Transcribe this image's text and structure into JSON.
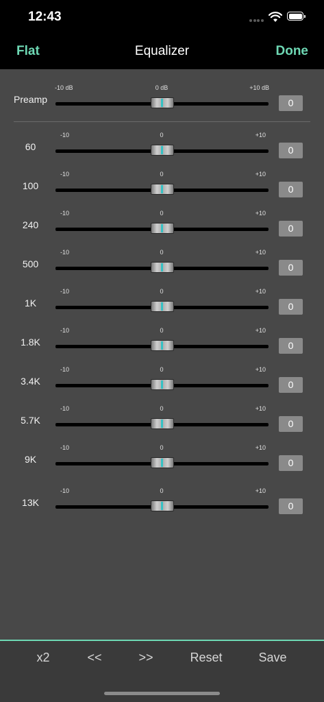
{
  "status_bar": {
    "time": "12:43"
  },
  "nav": {
    "left_button": "Flat",
    "title": "Equalizer",
    "right_button": "Done"
  },
  "preamp": {
    "label": "Preamp",
    "min_label": "-10 dB",
    "mid_label": "0 dB",
    "max_label": "+10 dB",
    "min": -10,
    "max": 10,
    "value": 0,
    "value_text": "0"
  },
  "bands": [
    {
      "label": "60",
      "min_label": "-10",
      "mid_label": "0",
      "max_label": "+10",
      "min": -10,
      "max": 10,
      "value": 0,
      "value_text": "0"
    },
    {
      "label": "100",
      "min_label": "-10",
      "mid_label": "0",
      "max_label": "+10",
      "min": -10,
      "max": 10,
      "value": 0,
      "value_text": "0"
    },
    {
      "label": "240",
      "min_label": "-10",
      "mid_label": "0",
      "max_label": "+10",
      "min": -10,
      "max": 10,
      "value": 0,
      "value_text": "0"
    },
    {
      "label": "500",
      "min_label": "-10",
      "mid_label": "0",
      "max_label": "+10",
      "min": -10,
      "max": 10,
      "value": 0,
      "value_text": "0"
    },
    {
      "label": "1K",
      "min_label": "-10",
      "mid_label": "0",
      "max_label": "+10",
      "min": -10,
      "max": 10,
      "value": 0,
      "value_text": "0"
    },
    {
      "label": "1.8K",
      "min_label": "-10",
      "mid_label": "0",
      "max_label": "+10",
      "min": -10,
      "max": 10,
      "value": 0,
      "value_text": "0"
    },
    {
      "label": "3.4K",
      "min_label": "-10",
      "mid_label": "0",
      "max_label": "+10",
      "min": -10,
      "max": 10,
      "value": 0,
      "value_text": "0"
    },
    {
      "label": "5.7K",
      "min_label": "-10",
      "mid_label": "0",
      "max_label": "+10",
      "min": -10,
      "max": 10,
      "value": 0,
      "value_text": "0"
    },
    {
      "label": "9K",
      "min_label": "-10",
      "mid_label": "0",
      "max_label": "+10",
      "min": -10,
      "max": 10,
      "value": 0,
      "value_text": "0"
    },
    {
      "label": "13K",
      "min_label": "-10",
      "mid_label": "0",
      "max_label": "+10",
      "min": -10,
      "max": 10,
      "value": 0,
      "value_text": "0"
    }
  ],
  "toolbar": {
    "x2": "x2",
    "prev": "<<",
    "next": ">>",
    "reset": "Reset",
    "save": "Save"
  },
  "colors": {
    "accent": "#6ed8b4",
    "thumb_line": "#35c1c4",
    "background": "#484848"
  }
}
